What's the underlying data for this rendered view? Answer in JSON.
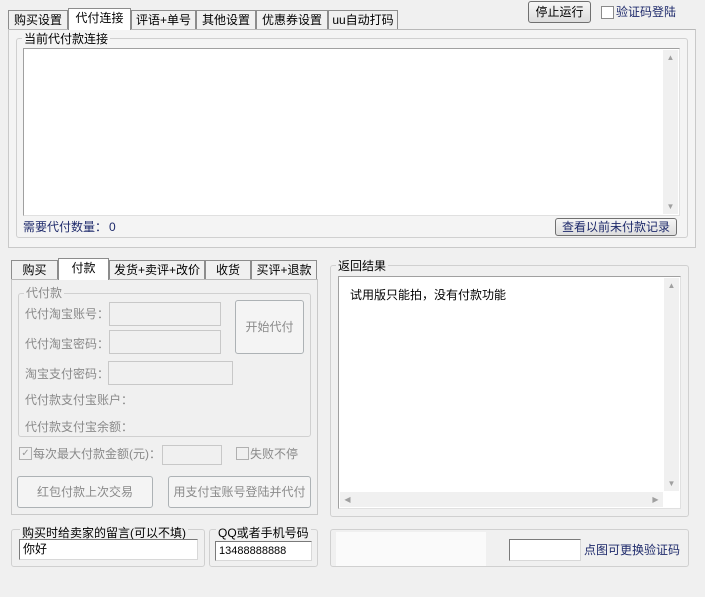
{
  "top_tabs": [
    "购买设置",
    "代付连接",
    "评语+单号",
    "其他设置",
    "优惠券设置",
    "uu自动打码"
  ],
  "stop_button": "停止运行",
  "verify_login_label": "验证码登陆",
  "link_group_label": "当前代付款连接",
  "link_text": "",
  "need_count_label": "需要代付数量：",
  "need_count_value": "0",
  "history_button": "查看以前未付款记录",
  "sub_tabs": [
    "购买",
    "付款",
    "发货+卖评+改价",
    "收货",
    "买评+退款"
  ],
  "daifu_group_label": "代付款",
  "taobao_account_label": "代付淘宝账号：",
  "taobao_password_label": "代付淘宝密码：",
  "pay_password_label": "淘宝支付密码：",
  "alipay_account_label": "代付款支付宝账户：",
  "alipay_balance_label": "代付款支付宝余额：",
  "start_daifu_button": "开始代付",
  "max_amount_label": "每次最大付款金额(元)：",
  "max_amount_value": "",
  "fail_continue_label": "失败不停",
  "redpacket_button": "红包付款上次交易",
  "alipay_login_button": "用支付宝账号登陆并代付",
  "result_group_label": "返回结果",
  "result_text": "试用版只能拍，没有付款功能",
  "message_label": "购买时给卖家的留言(可以不填)",
  "message_value": "你好",
  "qq_label": "QQ或者手机号码",
  "qq_value": "13488888888",
  "captcha_input_value": "",
  "captcha_hint": "点图可更换验证码"
}
